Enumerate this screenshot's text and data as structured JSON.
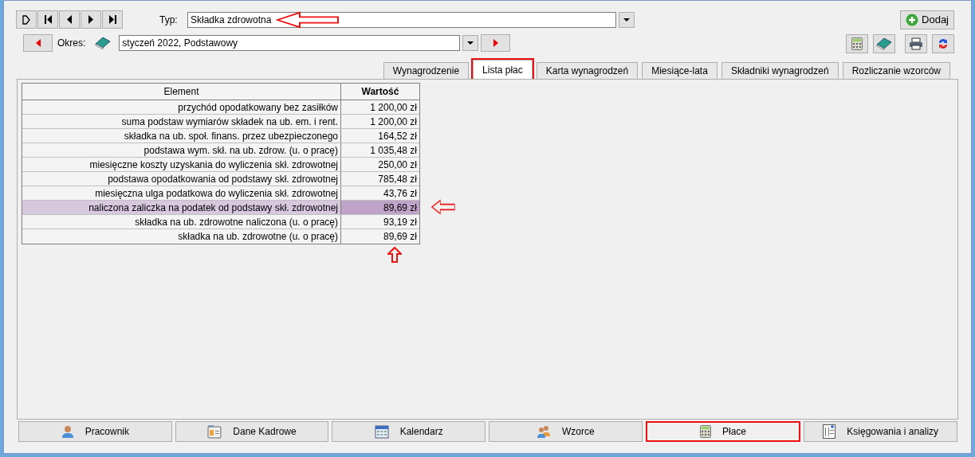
{
  "navigator": {
    "buttons": [
      {
        "kind": "new"
      },
      {
        "kind": "first"
      },
      {
        "kind": "prev"
      },
      {
        "kind": "next"
      },
      {
        "kind": "last"
      }
    ]
  },
  "typ": {
    "label": "Typ:",
    "value": "Składka zdrowotna",
    "arrow": true
  },
  "add_button": {
    "label": "Dodaj"
  },
  "okres": {
    "label": "Okres:",
    "value": "styczeń 2022, Podstawowy"
  },
  "toolbar": [
    {
      "kind": "calculator"
    },
    {
      "kind": "book"
    },
    {
      "kind": "print"
    },
    {
      "kind": "refresh"
    }
  ],
  "tabs": [
    {
      "label": "Wynagrodzenie",
      "selected": false,
      "marked": false
    },
    {
      "label": "Lista płac",
      "selected": true,
      "marked": true
    },
    {
      "label": "Karta wynagrodzeń",
      "selected": false,
      "marked": false
    },
    {
      "label": "Miesiące-lata",
      "selected": false,
      "marked": false
    },
    {
      "label": "Składniki wynagrodzeń",
      "selected": false,
      "marked": false
    },
    {
      "label": "Rozliczanie wzorców",
      "selected": false,
      "marked": false
    }
  ],
  "table": {
    "columns": [
      "Element",
      "Wartość"
    ],
    "rows": [
      {
        "element": "przychód opodatkowany bez zasiłków",
        "value": "1 200,00 zł",
        "selected": false
      },
      {
        "element": "suma podstaw wymiarów składek na ub. em. i rent.",
        "value": "1 200,00 zł",
        "selected": false
      },
      {
        "element": "składka na ub. społ. finans. przez ubezpieczonego",
        "value": "164,52 zł",
        "selected": false
      },
      {
        "element": "podstawa wym. skł. na ub. zdrow. (u. o pracę)",
        "value": "1 035,48 zł",
        "selected": false
      },
      {
        "element": "miesięczne koszty uzyskania do wyliczenia skł. zdrowotnej",
        "value": "250,00 zł",
        "selected": false
      },
      {
        "element": "podstawa opodatkowania od podstawy skł. zdrowotnej",
        "value": "785,48 zł",
        "selected": false
      },
      {
        "element": "miesięczna ulga podatkowa do wyliczenia skł. zdrowotnej",
        "value": "43,76 zł",
        "selected": false
      },
      {
        "element": "naliczona zaliczka na podatek od podstawy skł. zdrowotnej",
        "value": "89,69 zł",
        "selected": true,
        "arrow_beside": true
      },
      {
        "element": "składka na ub. zdrowotne naliczona (u. o pracę)",
        "value": "93,19 zł",
        "selected": false
      },
      {
        "element": "składka na ub. zdrowotne (u. o pracę)",
        "value": "89,69 zł",
        "selected": false,
        "arrow_below": true
      }
    ]
  },
  "bottom_buttons": [
    {
      "label": "Pracownik",
      "kind": "person",
      "marked": false
    },
    {
      "label": "Dane Kadrowe",
      "kind": "card",
      "marked": false
    },
    {
      "label": "Kalendarz",
      "kind": "calendar",
      "marked": false
    },
    {
      "label": "Wzorce",
      "kind": "people",
      "marked": false
    },
    {
      "label": "Płace",
      "kind": "calculator",
      "marked": true
    },
    {
      "label": "Księgowania i analizy",
      "kind": "ledger",
      "marked": false
    }
  ]
}
